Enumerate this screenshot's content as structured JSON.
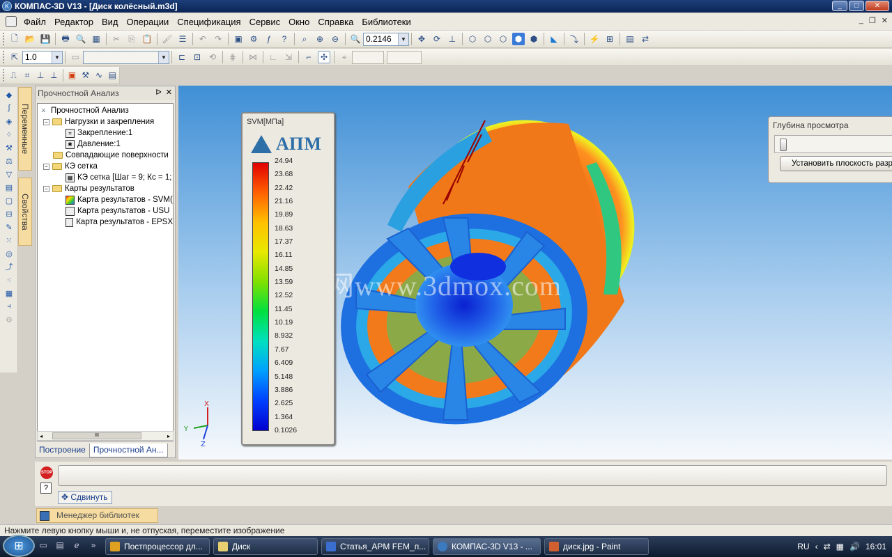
{
  "window": {
    "title": "КОМПАС-3D V13 - [Диск колёсный.m3d]",
    "app_icon": "kompas-icon"
  },
  "menu": [
    "Файл",
    "Редактор",
    "Вид",
    "Операции",
    "Спецификация",
    "Сервис",
    "Окно",
    "Справка",
    "Библиотеки"
  ],
  "toolbar": {
    "zoom_value": "0.2146",
    "step_value": "1.0",
    "style_value": ""
  },
  "left_tabs": [
    "Переменные",
    "Свойства"
  ],
  "tree_panel": {
    "title": "Прочностной Анализ",
    "nodes": [
      {
        "label": "Прочностной Анализ"
      },
      {
        "label": "Нагрузки и закрепления"
      },
      {
        "label": "Закрепление:1"
      },
      {
        "label": "Давление:1"
      },
      {
        "label": "Совпадающие поверхности"
      },
      {
        "label": "КЭ сетка"
      },
      {
        "label": "КЭ сетка [Шаг = 9; Кс = 1;"
      },
      {
        "label": "Карты результатов"
      },
      {
        "label": "Карта результатов - SVM("
      },
      {
        "label": "Карта результатов - USU"
      },
      {
        "label": "Карта результатов - EPSX"
      }
    ],
    "scroll_thumb": "III",
    "tabs": [
      "Построение",
      "Прочностной Ан..."
    ]
  },
  "legend": {
    "title": "SVM[МПа]",
    "logo": "АПМ",
    "values": [
      "24.94",
      "23.68",
      "22.42",
      "21.16",
      "19.89",
      "18.63",
      "17.37",
      "16.11",
      "14.85",
      "13.59",
      "12.52",
      "11.45",
      "10.19",
      "8.932",
      "7.67",
      "6.409",
      "5.148",
      "3.886",
      "2.625",
      "1.364",
      "0.1026"
    ]
  },
  "depth_panel": {
    "title": "Глубина просмотра",
    "slider_value": 0.03,
    "button_label": "Установить плоскость разреза"
  },
  "watermark": "三维网www.3dmox.com",
  "axes": {
    "x": "X",
    "y": "Y",
    "z": "Z"
  },
  "command": {
    "shift_label": "Сдвинуть"
  },
  "library_manager": "Менеджер библиотек",
  "status": "Нажмите левую кнопку мыши и, не отпуская, переместите изображение",
  "taskbar": {
    "tasks": [
      {
        "label": "Постпроцессор дл...",
        "icon_color": "#e0a020"
      },
      {
        "label": "Диск",
        "icon_color": "#e8d070"
      },
      {
        "label": "Статья_APM FEM_п...",
        "icon_color": "#3a6fd0"
      },
      {
        "label": "КОМПАС-3D V13 - ...",
        "icon_color": "#3c7ac0"
      },
      {
        "label": "диск.jpg - Paint",
        "icon_color": "#d06030"
      }
    ],
    "lang": "RU",
    "time": "16:01"
  }
}
